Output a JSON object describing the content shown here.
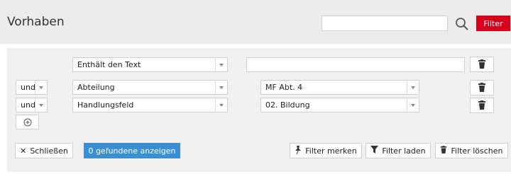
{
  "header": {
    "title": "Vorhaben",
    "search": {
      "value": "",
      "placeholder": ""
    },
    "filter_label": "Filter",
    "accent_color": "#d9001b"
  },
  "filters": {
    "row1": {
      "operator": "Enthält den Text",
      "value": ""
    },
    "row2": {
      "conjunction": "und",
      "field": "Abteilung",
      "value": "MF Abt. 4"
    },
    "row3": {
      "conjunction": "und",
      "field": "Handlungsfeld",
      "value": "02. Bildung"
    },
    "add_icon": "plus-circle-icon",
    "delete_icon": "trash-icon"
  },
  "actions": {
    "close_label": "Schließen",
    "show_results_label": "0 gefundene anzeigen",
    "remember_label": "Filter merken",
    "load_label": "Filter laden",
    "delete_label": "Filter löschen",
    "primary_color": "#3a8ed4"
  }
}
